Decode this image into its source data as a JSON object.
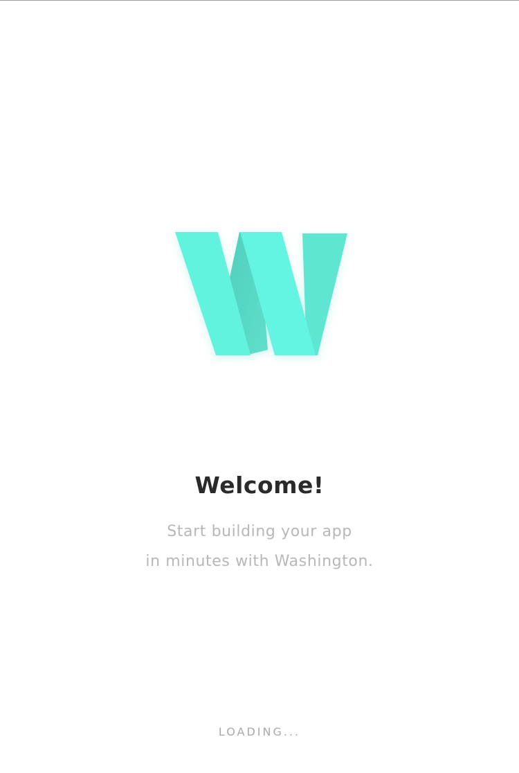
{
  "brand": {
    "logo_icon": "washington-w-logo",
    "logo_letter": "W",
    "accent_color": "#62F3DF",
    "accent_shade": "#55D9C6"
  },
  "welcome": {
    "title": "Welcome!",
    "subtitle_line1": "Start building your app",
    "subtitle_line2": "in minutes with Washington."
  },
  "status": {
    "loading_label": "LOADING..."
  }
}
